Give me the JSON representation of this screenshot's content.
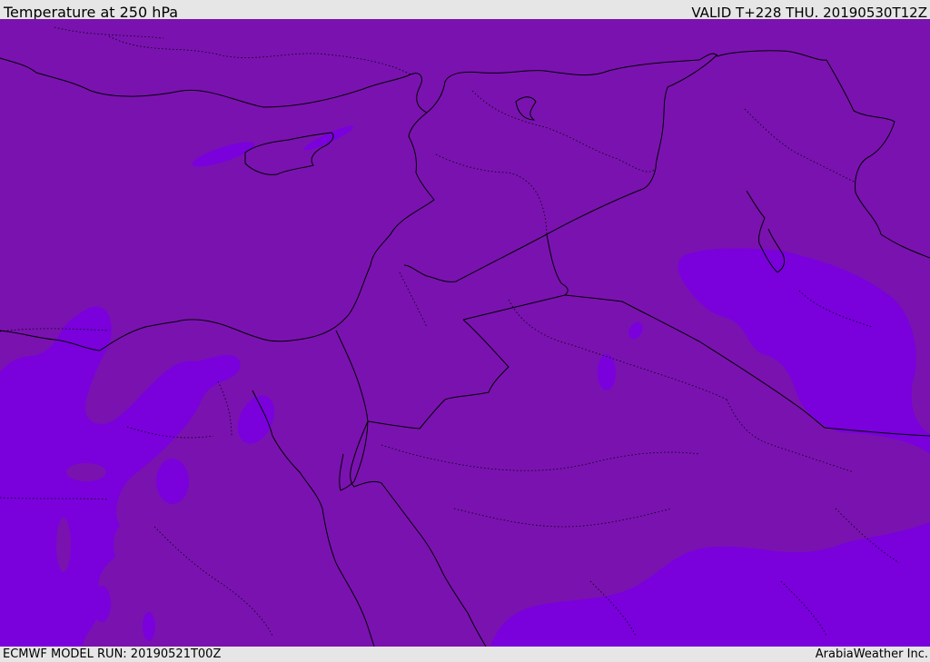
{
  "header": {
    "title": "Temperature at 250 hPa",
    "valid_time": "VALID T+228 THU. 20190530T12Z"
  },
  "footer": {
    "model_run": "ECMWF MODEL RUN: 20190521T00Z",
    "credit": "ArabiaWeather Inc."
  },
  "colors": {
    "base_fill": "#7a12b0",
    "warmer_fill": "#7a00dc",
    "coastline": "#000000",
    "border": "#000000"
  }
}
